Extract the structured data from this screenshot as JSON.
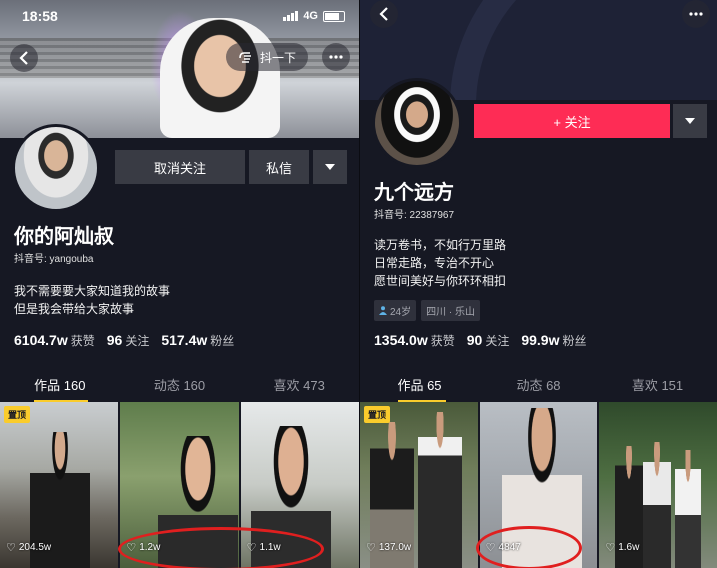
{
  "left": {
    "status": {
      "time": "18:58",
      "network": "4G"
    },
    "shake_label": "抖一下",
    "actions": {
      "unfollow": "取消关注",
      "message": "私信"
    },
    "name": "你的阿灿叔",
    "douyin_id": "抖音号: yangouba",
    "bio": [
      "我不需要要大家知道我的故事",
      "但是我会带给大家故事"
    ],
    "stats": [
      {
        "value": "6104.7w",
        "label": "获赞"
      },
      {
        "value": "96",
        "label": "关注"
      },
      {
        "value": "517.4w",
        "label": "粉丝"
      }
    ],
    "tabs": [
      {
        "label": "作品 160",
        "active": true
      },
      {
        "label": "动态 160",
        "active": false
      },
      {
        "label": "喜欢 473",
        "active": false
      }
    ],
    "videos": [
      {
        "pinned": "置顶",
        "likes": "204.5w"
      },
      {
        "likes": "1.2w"
      },
      {
        "likes": "1.1w"
      }
    ]
  },
  "right": {
    "follow_label": "+ 关注",
    "name": "九个远方",
    "douyin_id": "抖音号: 22387967",
    "bio": [
      "读万卷书，不如行万里路",
      "日常走路，专治不开心",
      "愿世间美好与你环环相扣"
    ],
    "tags": [
      {
        "icon": "person-icon",
        "label": "24岁"
      },
      {
        "label": "四川 · 乐山"
      }
    ],
    "stats": [
      {
        "value": "1354.0w",
        "label": "获赞"
      },
      {
        "value": "90",
        "label": "关注"
      },
      {
        "value": "99.9w",
        "label": "粉丝"
      }
    ],
    "tabs": [
      {
        "label": "作品 65",
        "active": true
      },
      {
        "label": "动态 68",
        "active": false
      },
      {
        "label": "喜欢 151",
        "active": false
      }
    ],
    "videos": [
      {
        "pinned": "置顶",
        "likes": "137.0w"
      },
      {
        "likes": "4847"
      },
      {
        "likes": "1.6w"
      }
    ]
  },
  "colors": {
    "background": "#161823",
    "accent_red": "#fe2c55",
    "tab_indicator": "#facc2c",
    "annotation_circle": "#e01f1f"
  }
}
